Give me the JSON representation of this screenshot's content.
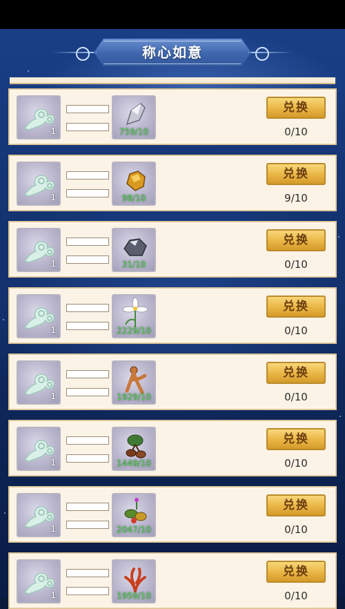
{
  "title": "称心如意",
  "exchange_label": "兑换",
  "rows": [
    {
      "cost_count": "1",
      "reward_icon": "crystal-shard-icon",
      "reward_count": "759/10",
      "progress": "0/10"
    },
    {
      "cost_count": "1",
      "reward_icon": "gold-ore-icon",
      "reward_count": "98/10",
      "progress": "9/10"
    },
    {
      "cost_count": "1",
      "reward_icon": "iron-ore-icon",
      "reward_count": "31/10",
      "progress": "0/10"
    },
    {
      "cost_count": "1",
      "reward_icon": "white-flower-icon",
      "reward_count": "2229/10",
      "progress": "0/10"
    },
    {
      "cost_count": "1",
      "reward_icon": "ginseng-root-icon",
      "reward_count": "1929/10",
      "progress": "0/10"
    },
    {
      "cost_count": "1",
      "reward_icon": "herb-bulb-icon",
      "reward_count": "1449/10",
      "progress": "0/10"
    },
    {
      "cost_count": "1",
      "reward_icon": "berry-plant-icon",
      "reward_count": "2047/10",
      "progress": "0/10"
    },
    {
      "cost_count": "1",
      "reward_icon": "red-coral-icon",
      "reward_count": "1959/10",
      "progress": "0/10"
    }
  ],
  "cost_icon": "jade-ruyi-icon"
}
